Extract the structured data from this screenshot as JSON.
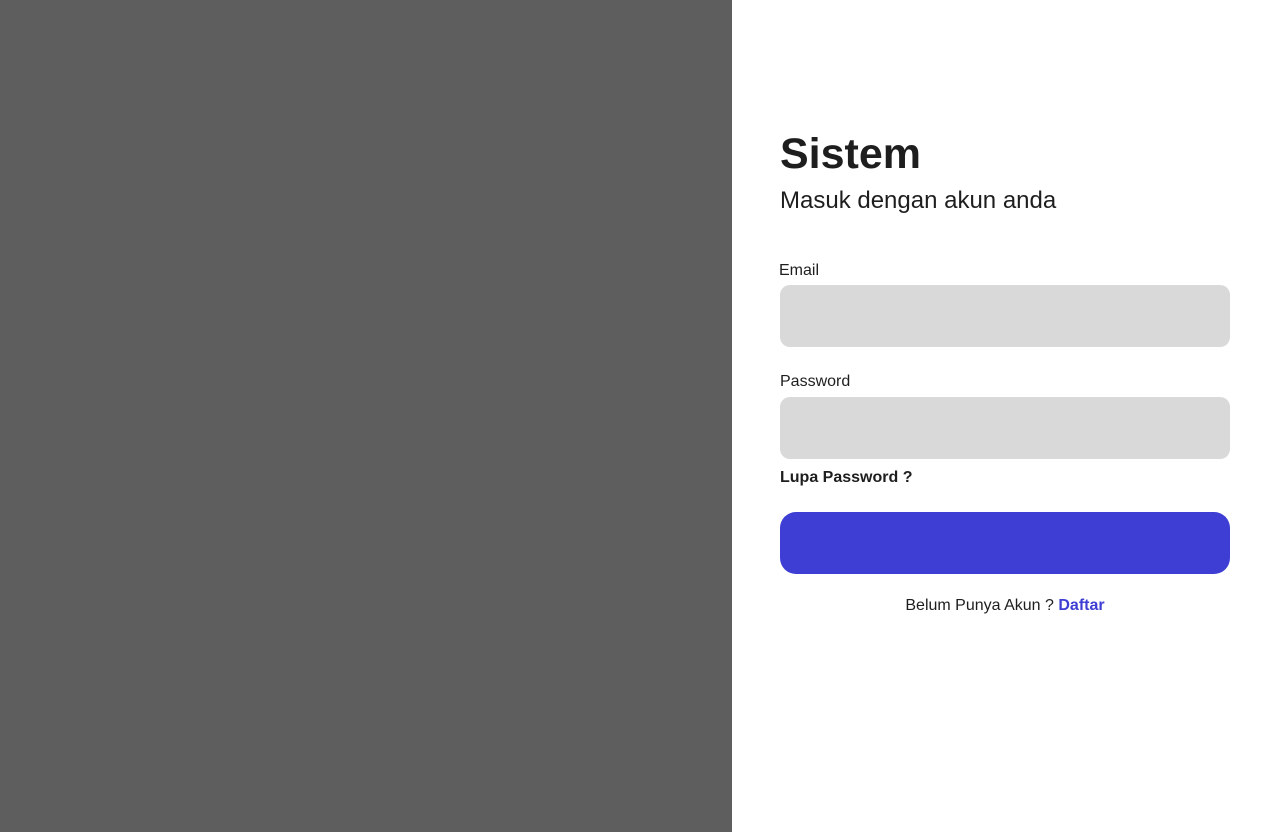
{
  "app": {
    "title": "Sistem",
    "subtitle": "Masuk dengan akun anda"
  },
  "form": {
    "email_label": "Email",
    "email_value": "",
    "email_placeholder": "",
    "password_label": "Password",
    "password_value": "",
    "password_placeholder": "",
    "forgot_password": "Lupa Password ?",
    "submit_label": ""
  },
  "register": {
    "prompt": "Belum Punya Akun ?",
    "link_label": "Daftar"
  },
  "colors": {
    "image_panel": "#5e5e5e",
    "input_background": "#d9d9d9",
    "accent": "#3e3ed4",
    "text": "#1e1e1e"
  }
}
